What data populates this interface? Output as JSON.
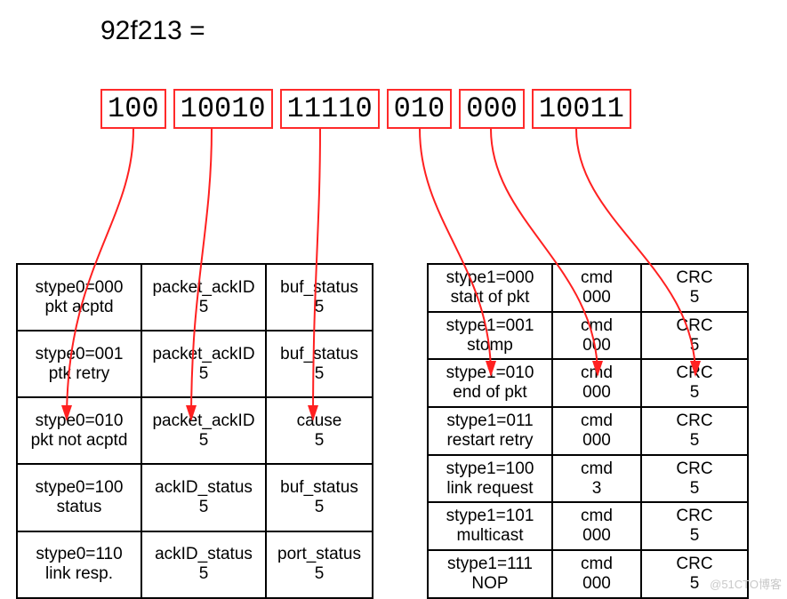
{
  "heading": "92f213 =",
  "bit_groups": [
    "100",
    "10010",
    "11110",
    "010",
    "000",
    "10011"
  ],
  "left_table": {
    "rows": [
      {
        "c0a": "stype0=000",
        "c0b": "pkt acptd",
        "c1a": "packet_ackID",
        "c1b": "5",
        "c2a": "buf_status",
        "c2b": "5"
      },
      {
        "c0a": "stype0=001",
        "c0b": "ptk retry",
        "c1a": "packet_ackID",
        "c1b": "5",
        "c2a": "buf_status",
        "c2b": "5"
      },
      {
        "c0a": "stype0=010",
        "c0b": "pkt not acptd",
        "c1a": "packet_ackID",
        "c1b": "5",
        "c2a": "cause",
        "c2b": "5"
      },
      {
        "c0a": "stype0=100",
        "c0b": "status",
        "c1a": "ackID_status",
        "c1b": "5",
        "c2a": "buf_status",
        "c2b": "5"
      },
      {
        "c0a": "stype0=110",
        "c0b": "link resp.",
        "c1a": "ackID_status",
        "c1b": "5",
        "c2a": "port_status",
        "c2b": "5"
      }
    ]
  },
  "right_table": {
    "rows": [
      {
        "c0a": "stype1=000",
        "c0b": "start of pkt",
        "c1a": "cmd",
        "c1b": "000",
        "c2a": "CRC",
        "c2b": "5"
      },
      {
        "c0a": "stype1=001",
        "c0b": "stomp",
        "c1a": "cmd",
        "c1b": "000",
        "c2a": "CRC",
        "c2b": "5"
      },
      {
        "c0a": "stype1=010",
        "c0b": "end of pkt",
        "c1a": "cmd",
        "c1b": "000",
        "c2a": "CRC",
        "c2b": "5"
      },
      {
        "c0a": "stype1=011",
        "c0b": "restart retry",
        "c1a": "cmd",
        "c1b": "000",
        "c2a": "CRC",
        "c2b": "5"
      },
      {
        "c0a": "stype1=100",
        "c0b": "link request",
        "c1a": "cmd",
        "c1b": "3",
        "c2a": "CRC",
        "c2b": "5"
      },
      {
        "c0a": "stype1=101",
        "c0b": "multicast",
        "c1a": "cmd",
        "c1b": "000",
        "c2a": "CRC",
        "c2b": "5"
      },
      {
        "c0a": "stype1=111",
        "c0b": "NOP",
        "c1a": "cmd",
        "c1b": "000",
        "c2a": "CRC",
        "c2b": "5"
      }
    ]
  },
  "chart_data": {
    "type": "table",
    "title": "RapidIO short control symbol decode of 92f213",
    "hex": "92f213",
    "binary_groups": [
      "100",
      "10010",
      "11110",
      "010",
      "000",
      "10011"
    ],
    "stype0_fields": [
      {
        "stype0": "000",
        "label": "pkt acptd",
        "field1": "packet_ackID",
        "bits1": 5,
        "field2": "buf_status",
        "bits2": 5
      },
      {
        "stype0": "001",
        "label": "ptk retry",
        "field1": "packet_ackID",
        "bits1": 5,
        "field2": "buf_status",
        "bits2": 5
      },
      {
        "stype0": "010",
        "label": "pkt not acptd",
        "field1": "packet_ackID",
        "bits1": 5,
        "field2": "cause",
        "bits2": 5
      },
      {
        "stype0": "100",
        "label": "status",
        "field1": "ackID_status",
        "bits1": 5,
        "field2": "buf_status",
        "bits2": 5
      },
      {
        "stype0": "110",
        "label": "link resp.",
        "field1": "ackID_status",
        "bits1": 5,
        "field2": "port_status",
        "bits2": 5
      }
    ],
    "stype1_fields": [
      {
        "stype1": "000",
        "label": "start of pkt",
        "cmd": "000",
        "crc_bits": 5
      },
      {
        "stype1": "001",
        "label": "stomp",
        "cmd": "000",
        "crc_bits": 5
      },
      {
        "stype1": "010",
        "label": "end of pkt",
        "cmd": "000",
        "crc_bits": 5
      },
      {
        "stype1": "011",
        "label": "restart retry",
        "cmd": "000",
        "crc_bits": 5
      },
      {
        "stype1": "100",
        "label": "link request",
        "cmd": "3",
        "crc_bits": 5
      },
      {
        "stype1": "101",
        "label": "multicast",
        "cmd": "000",
        "crc_bits": 5
      },
      {
        "stype1": "111",
        "label": "NOP",
        "cmd": "000",
        "crc_bits": 5
      }
    ],
    "arrows": [
      {
        "from_group": 0,
        "to_table": "stype0",
        "to_row": 3,
        "to_col": 0
      },
      {
        "from_group": 1,
        "to_table": "stype0",
        "to_row": 3,
        "to_col": 1
      },
      {
        "from_group": 2,
        "to_table": "stype0",
        "to_row": 3,
        "to_col": 2
      },
      {
        "from_group": 3,
        "to_table": "stype1",
        "to_row": 2,
        "to_col": 0
      },
      {
        "from_group": 4,
        "to_table": "stype1",
        "to_row": 2,
        "to_col": 1
      },
      {
        "from_group": 5,
        "to_table": "stype1",
        "to_row": 2,
        "to_col": 2
      }
    ]
  },
  "watermark": "@51CTO博客"
}
